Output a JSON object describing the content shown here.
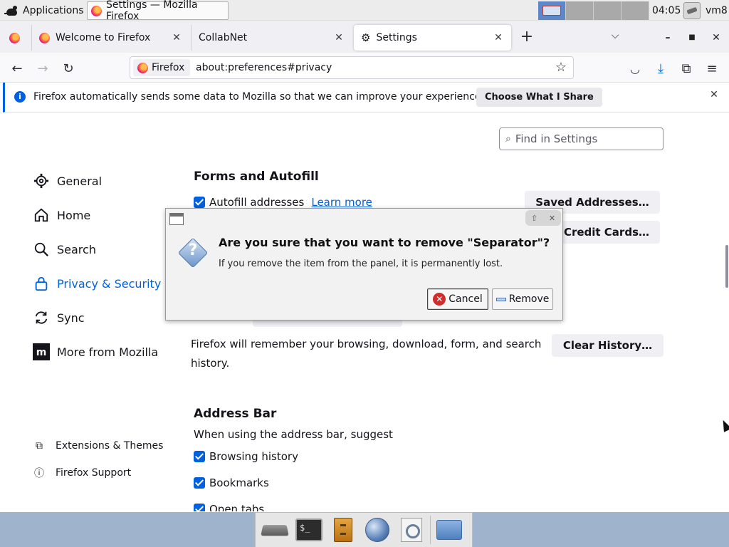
{
  "desktop": {
    "apps_label": "Applications",
    "task_title": "Settings — Mozilla Firefox",
    "clock": "04:05",
    "hostname": "vm8"
  },
  "browser": {
    "tabs": [
      {
        "label": "Welcome to Firefox"
      },
      {
        "label": "CollabNet"
      },
      {
        "label": "Settings"
      }
    ],
    "identity_label": "Firefox",
    "url": "about:preferences#privacy"
  },
  "notification": {
    "text": "Firefox automatically sends some data to Mozilla so that we can improve your experience.",
    "button": "Choose What I Share"
  },
  "settings": {
    "search_placeholder": "Find in Settings",
    "sidebar": [
      {
        "label": "General",
        "icon": "gear-icon"
      },
      {
        "label": "Home",
        "icon": "home-icon"
      },
      {
        "label": "Search",
        "icon": "search-icon"
      },
      {
        "label": "Privacy & Security",
        "icon": "lock-icon"
      },
      {
        "label": "Sync",
        "icon": "sync-icon"
      },
      {
        "label": "More from Mozilla",
        "icon": "mozilla-icon"
      }
    ],
    "sidebar_footer": [
      {
        "label": "Extensions & Themes",
        "icon": "puzzle-icon"
      },
      {
        "label": "Firefox Support",
        "icon": "help-icon"
      }
    ],
    "forms_section": {
      "title": "Forms and Autofill",
      "autofill_label": "Autofill addresses",
      "learn_more": "Learn more",
      "saved_addresses_button": "Saved Addresses…",
      "credit_cards_button": "Credit Cards…"
    },
    "history": {
      "text_line1": "Firefox will remember your browsing, download, form, and search",
      "text_line2": "history.",
      "clear_button": "Clear History…"
    },
    "address_bar": {
      "title": "Address Bar",
      "subtitle": "When using the address bar, suggest",
      "options": [
        "Browsing history",
        "Bookmarks",
        "Open tabs"
      ]
    }
  },
  "dialog": {
    "title": "Are you sure that you want to remove \"Separator\"?",
    "message": "If you remove the item from the panel, it is permanently lost.",
    "cancel": "Cancel",
    "remove": "Remove"
  },
  "colors": {
    "accent": "#0061e0",
    "cancel_icon": "#d42b2b"
  }
}
